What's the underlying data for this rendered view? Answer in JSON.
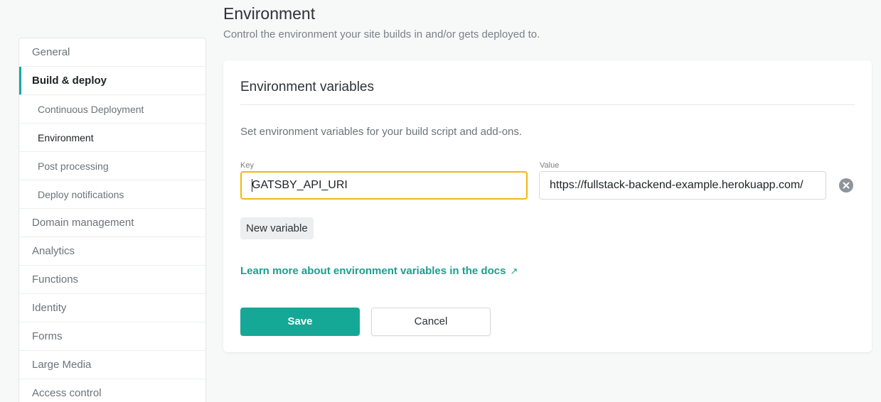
{
  "header": {
    "title": "Environment",
    "subtitle": "Control the environment your site builds in and/or gets deployed to."
  },
  "sidebar": {
    "items": [
      {
        "label": "General"
      },
      {
        "label": "Build & deploy",
        "active": true
      },
      {
        "label": "Continuous Deployment",
        "sub": true
      },
      {
        "label": "Environment",
        "sub": true,
        "current": true
      },
      {
        "label": "Post processing",
        "sub": true
      },
      {
        "label": "Deploy notifications",
        "sub": true
      },
      {
        "label": "Domain management"
      },
      {
        "label": "Analytics"
      },
      {
        "label": "Functions"
      },
      {
        "label": "Identity"
      },
      {
        "label": "Forms"
      },
      {
        "label": "Large Media"
      },
      {
        "label": "Access control"
      }
    ]
  },
  "card": {
    "title": "Environment variables",
    "description": "Set environment variables for your build script and add-ons.",
    "key_label": "Key",
    "value_label": "Value",
    "key_value": "GATSBY_API_URI",
    "value_value": "https://fullstack-backend-example.herokuapp.com/",
    "new_variable_label": "New variable",
    "docs_link_label": "Learn more about environment variables in the docs",
    "docs_link_icon": "external-arrow-icon",
    "save_label": "Save",
    "cancel_label": "Cancel"
  },
  "colors": {
    "accent": "#15a896",
    "link": "#1aa08f",
    "focus_border": "#f2b90f",
    "active_indicator": "#15a8a0"
  }
}
